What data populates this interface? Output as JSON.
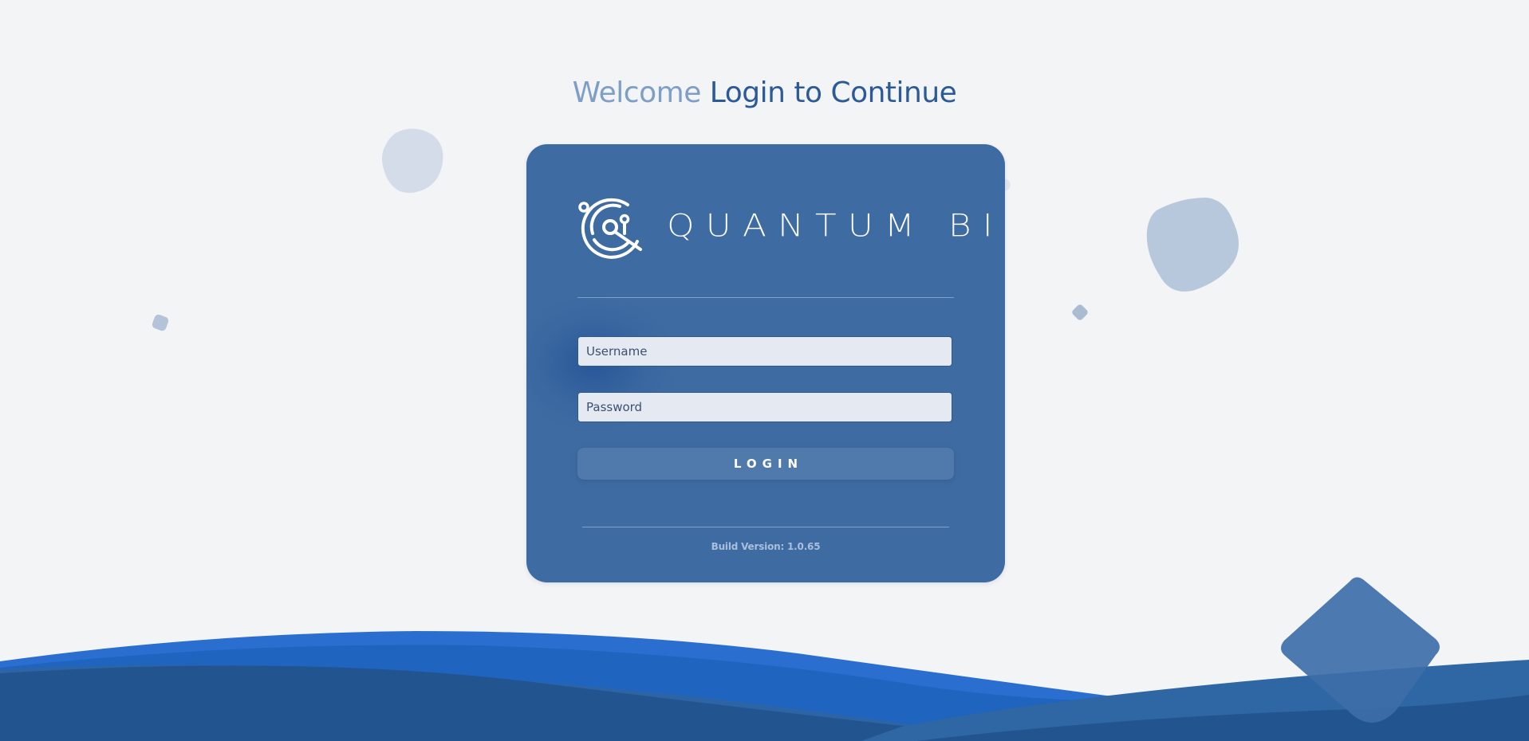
{
  "headline": {
    "welcome": "Welcome",
    "main": "Login to Continue"
  },
  "brand": {
    "name": "QUANTUM BI",
    "icon": "quantum-bi-logo-icon"
  },
  "form": {
    "username_placeholder": "Username",
    "username_value": "",
    "password_placeholder": "Password",
    "password_value": "",
    "login_label": "LOGIN"
  },
  "footer": {
    "build_version": "Build Version: 1.0.65"
  },
  "colors": {
    "background": "#f2f4f6",
    "card": "#3e6ba2",
    "headline_light": "#7f9ec7",
    "headline_dark": "#2c5a98",
    "wave_dark": "#22558f",
    "wave_bright": "#1e66c4",
    "button": "#5079ac"
  }
}
